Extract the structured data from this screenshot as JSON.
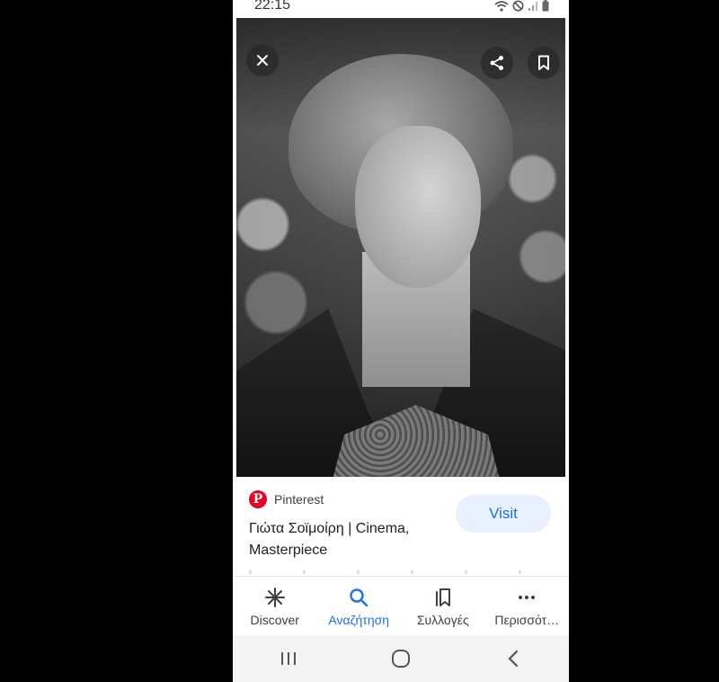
{
  "status_bar": {
    "time": "22:15"
  },
  "image_viewer": {
    "close_label": "close",
    "share_label": "share",
    "bookmark_label": "save"
  },
  "result": {
    "source": "Pinterest",
    "title": "Γιώτα Σοϊμοίρη | Cinema, Masterpiece",
    "visit_label": "Visit"
  },
  "bottom_nav": {
    "items": [
      {
        "label": "Discover",
        "icon": "asterisk-icon"
      },
      {
        "label": "Αναζήτηση",
        "icon": "search-icon",
        "active": true
      },
      {
        "label": "Συλλογές",
        "icon": "collections-icon"
      },
      {
        "label": "Περισσότ…",
        "icon": "more-icon"
      }
    ]
  },
  "colors": {
    "accent": "#1a73e8",
    "visit_bg": "#e8f0fe",
    "pinterest_red": "#e60023"
  }
}
